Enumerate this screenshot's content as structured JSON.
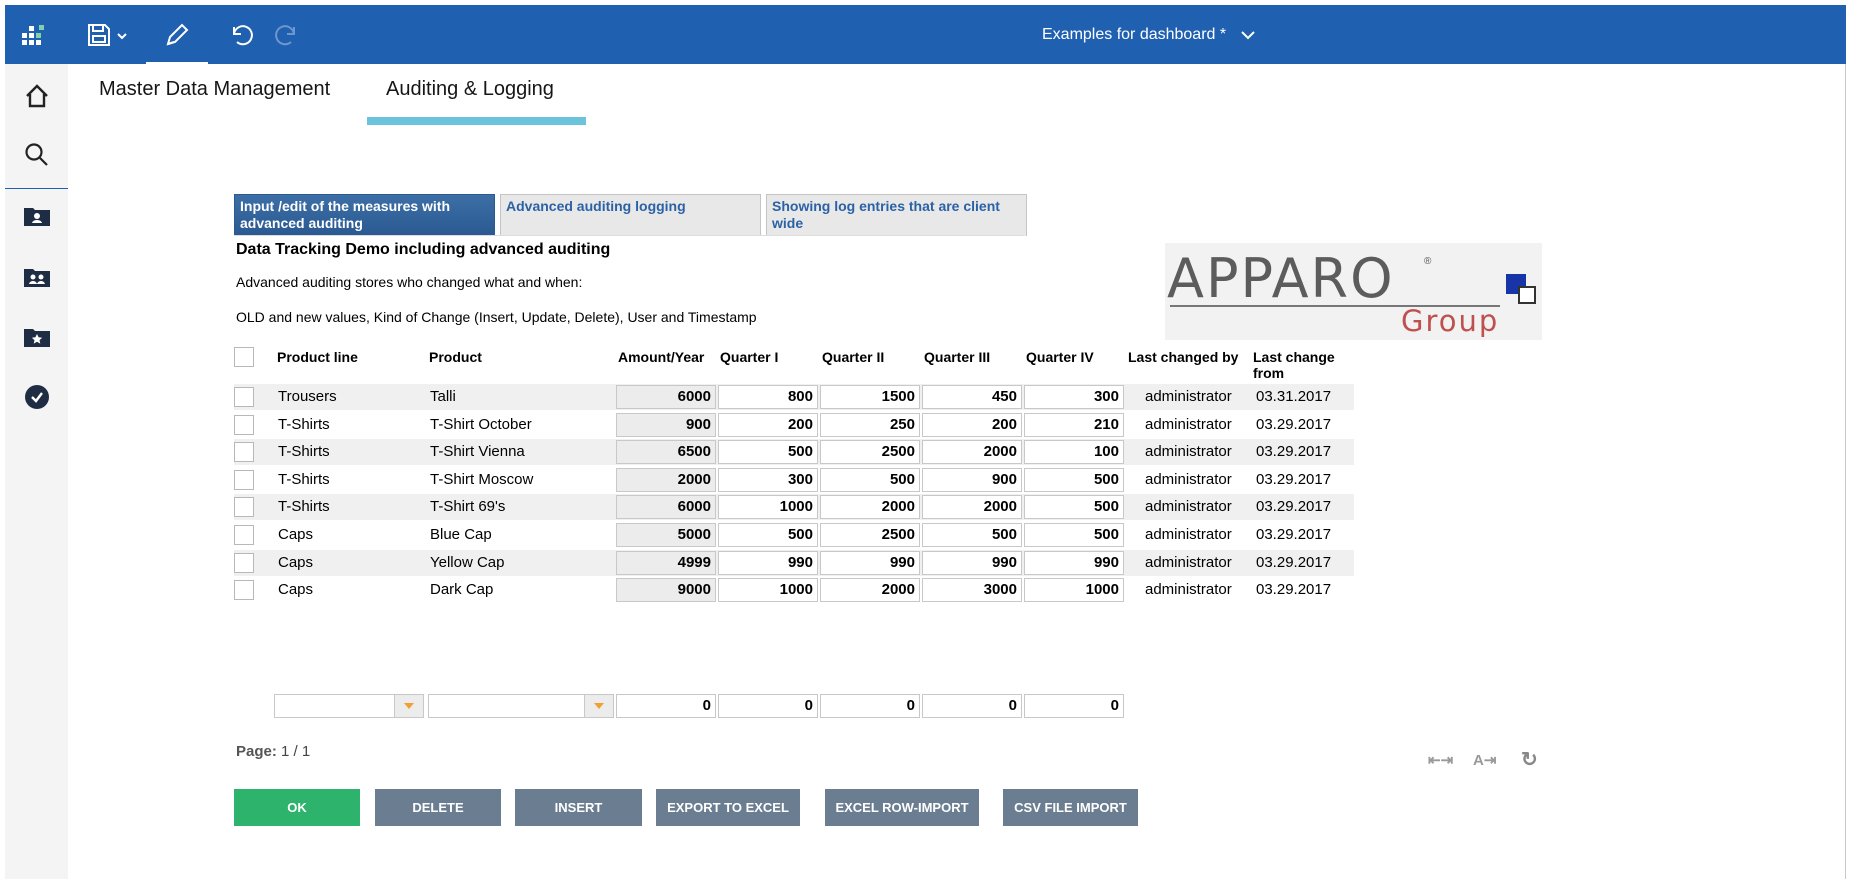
{
  "app": {
    "document_title": "Examples for dashboard *"
  },
  "main_tabs": [
    {
      "label": "Master Data Management",
      "active": false
    },
    {
      "label": "Auditing & Logging",
      "active": true
    }
  ],
  "sub_tabs": [
    {
      "label": "Input /edit of the measures with advanced auditing",
      "active": true
    },
    {
      "label": "Advanced auditing logging",
      "active": false
    },
    {
      "label": "Showing log entries that are client wide",
      "active": false
    }
  ],
  "content": {
    "heading": "Data Tracking Demo including advanced auditing",
    "desc1": "Advanced auditing stores who changed what and when:",
    "desc2": "OLD and new values, Kind of Change (Insert, Update, Delete), User and Timestamp"
  },
  "logo": {
    "main": "APPARO",
    "reg": "®",
    "group": "Group"
  },
  "table": {
    "headers": {
      "product_line": "Product line",
      "product": "Product",
      "amount_year": "Amount/Year",
      "q1": "Quarter I",
      "q2": "Quarter II",
      "q3": "Quarter III",
      "q4": "Quarter IV",
      "last_changed_by": "Last changed by",
      "last_change_from": "Last change from"
    },
    "rows": [
      {
        "product_line": "Trousers",
        "product": "Talli",
        "amount": "6000",
        "q1": "800",
        "q2": "1500",
        "q3": "450",
        "q4": "300",
        "changed_by": "administrator",
        "changed_from": "03.31.2017"
      },
      {
        "product_line": "T-Shirts",
        "product": "T-Shirt October",
        "amount": "900",
        "q1": "200",
        "q2": "250",
        "q3": "200",
        "q4": "210",
        "changed_by": "administrator",
        "changed_from": "03.29.2017"
      },
      {
        "product_line": "T-Shirts",
        "product": "T-Shirt Vienna",
        "amount": "6500",
        "q1": "500",
        "q2": "2500",
        "q3": "2000",
        "q4": "100",
        "changed_by": "administrator",
        "changed_from": "03.29.2017"
      },
      {
        "product_line": "T-Shirts",
        "product": "T-Shirt Moscow",
        "amount": "2000",
        "q1": "300",
        "q2": "500",
        "q3": "900",
        "q4": "500",
        "changed_by": "administrator",
        "changed_from": "03.29.2017"
      },
      {
        "product_line": "T-Shirts",
        "product": "T-Shirt 69's",
        "amount": "6000",
        "q1": "1000",
        "q2": "2000",
        "q3": "2000",
        "q4": "500",
        "changed_by": "administrator",
        "changed_from": "03.29.2017"
      },
      {
        "product_line": "Caps",
        "product": "Blue Cap",
        "amount": "5000",
        "q1": "500",
        "q2": "2500",
        "q3": "500",
        "q4": "500",
        "changed_by": "administrator",
        "changed_from": "03.29.2017"
      },
      {
        "product_line": "Caps",
        "product": "Yellow Cap",
        "amount": "4999",
        "q1": "990",
        "q2": "990",
        "q3": "990",
        "q4": "990",
        "changed_by": "administrator",
        "changed_from": "03.29.2017"
      },
      {
        "product_line": "Caps",
        "product": "Dark Cap",
        "amount": "9000",
        "q1": "1000",
        "q2": "2000",
        "q3": "3000",
        "q4": "1000",
        "changed_by": "administrator",
        "changed_from": "03.29.2017"
      }
    ],
    "new_row": {
      "amount": "0",
      "q1": "0",
      "q2": "0",
      "q3": "0",
      "q4": "0"
    }
  },
  "pagination": {
    "label": "Page:",
    "value": "1 / 1"
  },
  "controls": {
    "first_last": "⇤⇥",
    "text_fit": "A⇥",
    "refresh": "↻"
  },
  "buttons": {
    "ok": "OK",
    "delete": "DELETE",
    "insert": "INSERT",
    "export_excel": "EXPORT TO EXCEL",
    "excel_row_import": "EXCEL ROW-IMPORT",
    "csv_import": "CSV FILE IMPORT"
  },
  "colors": {
    "topbar": "#2060b0",
    "tab_underline": "#6cc4dc",
    "ok_button": "#2db36c",
    "gray_button": "#6b7e91"
  }
}
